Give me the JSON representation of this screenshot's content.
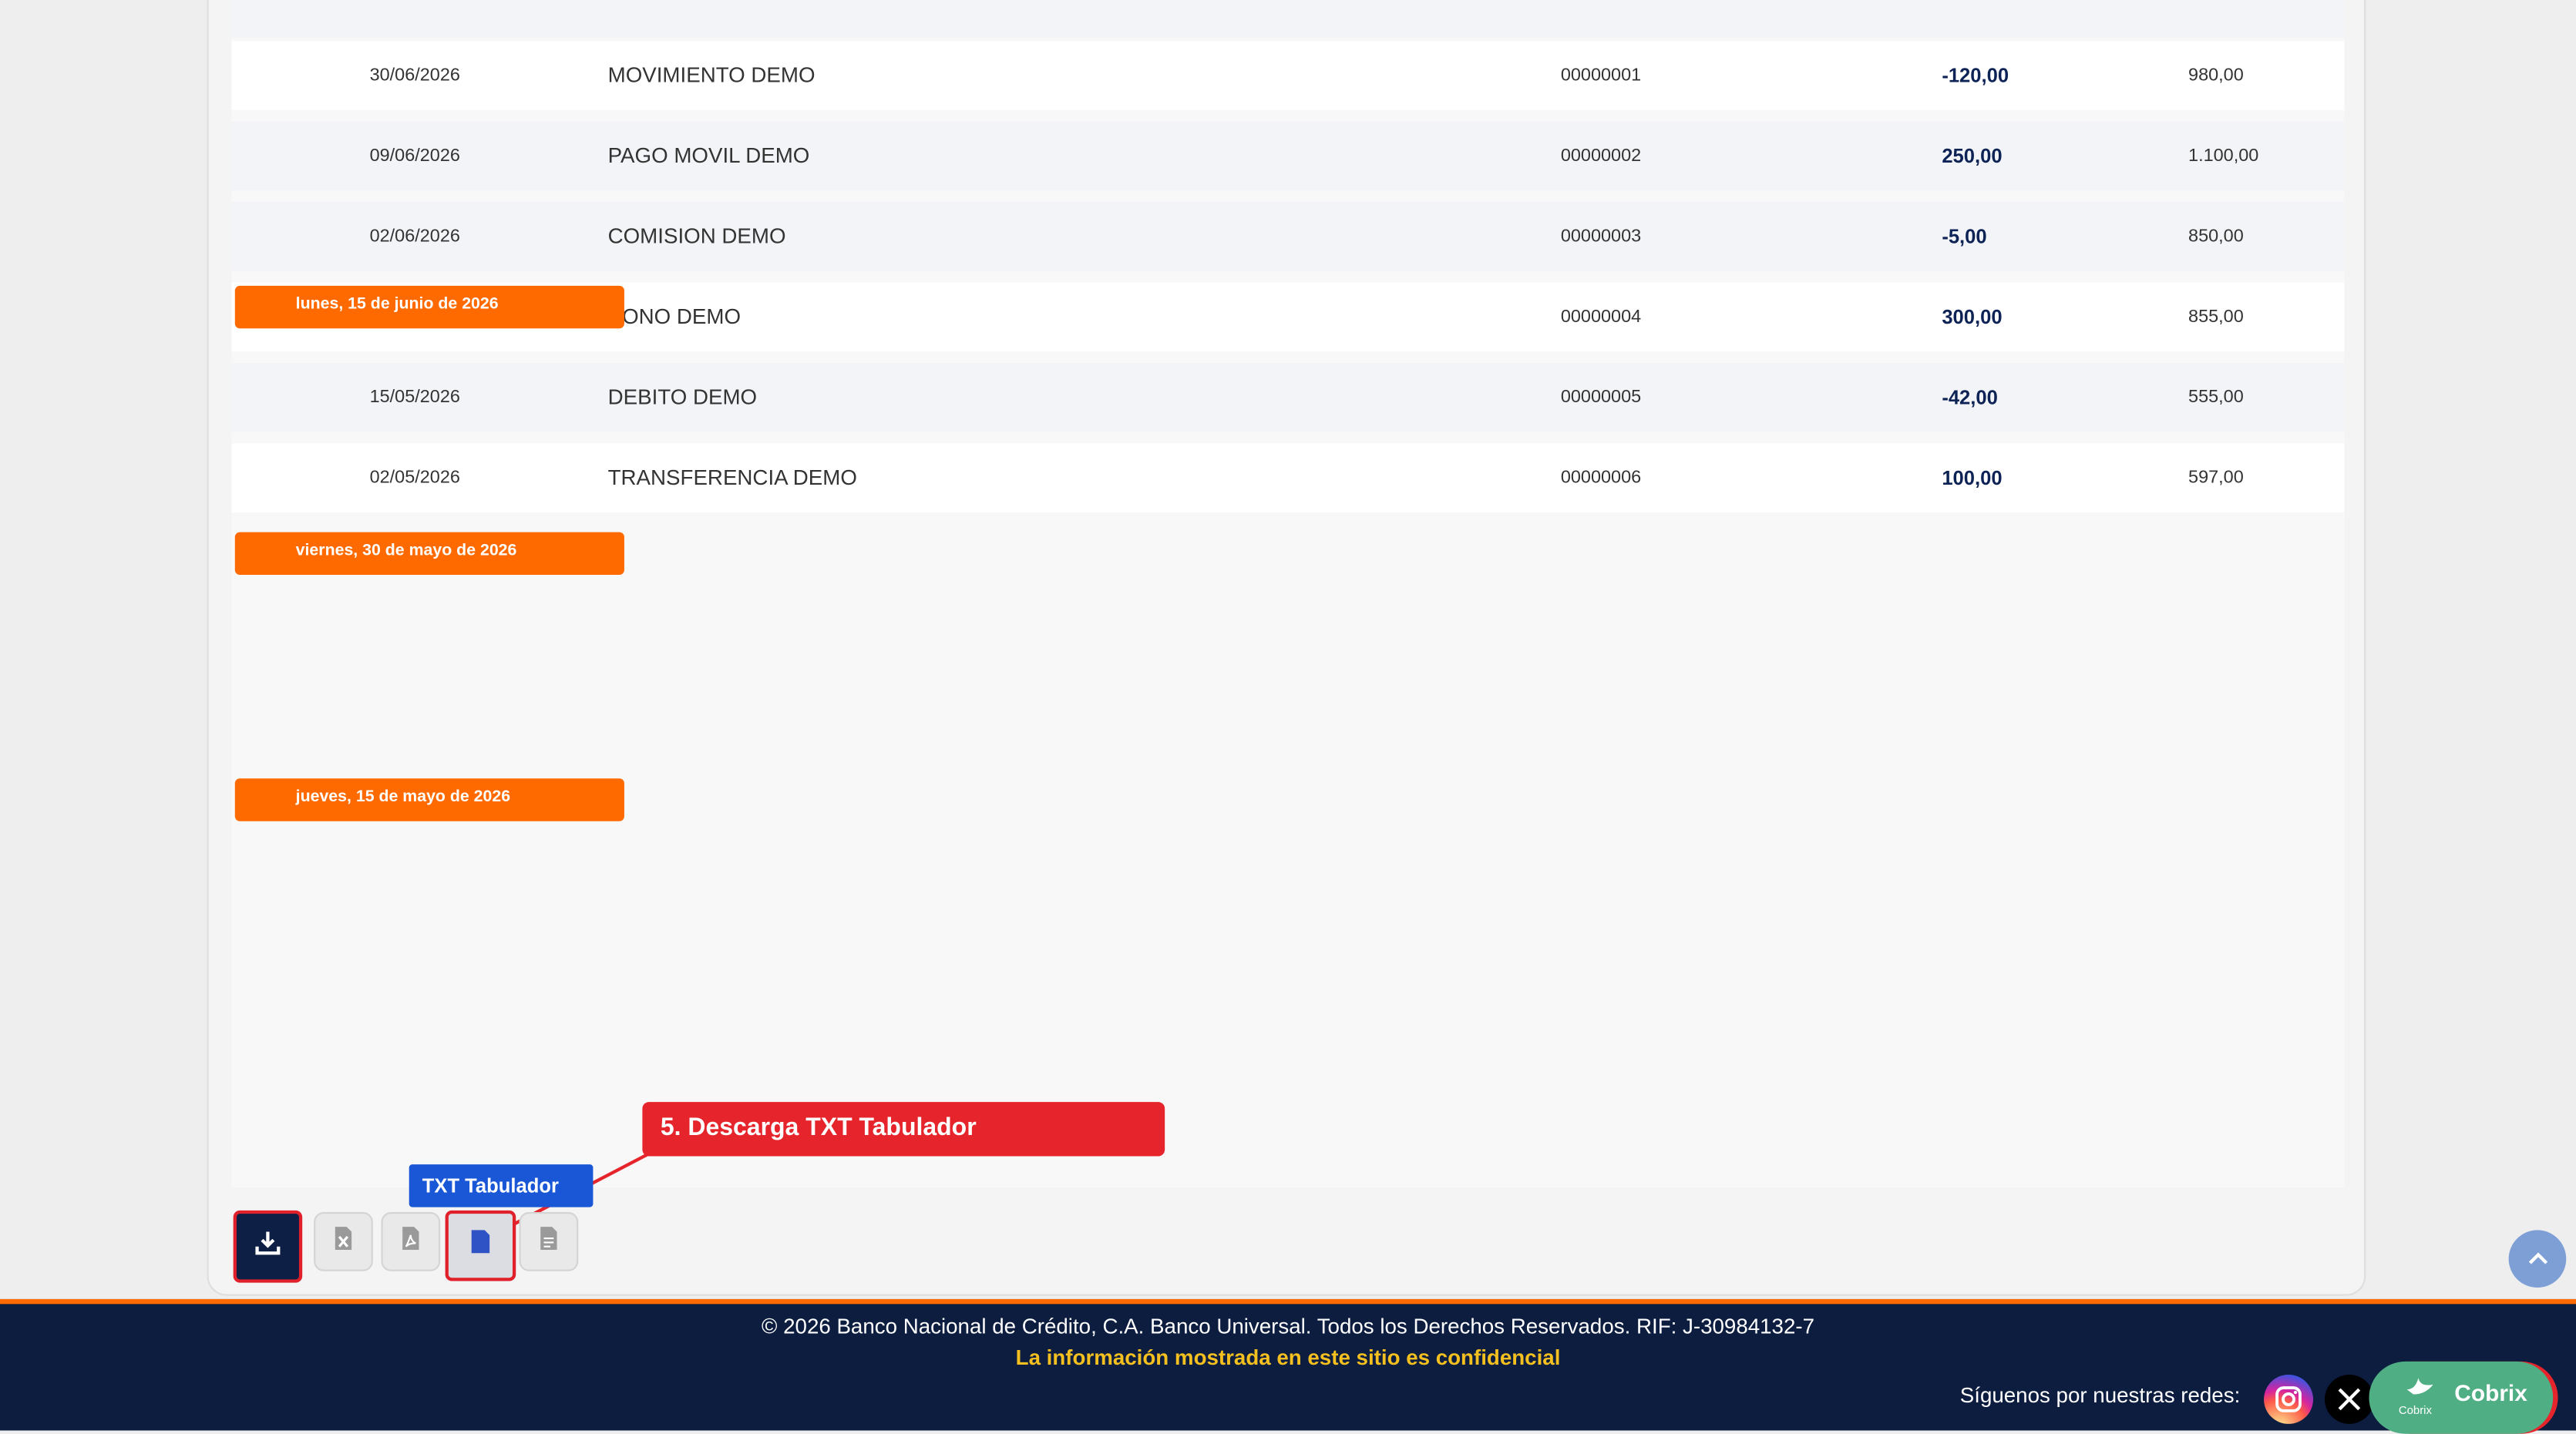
{
  "transactions": [
    {
      "date": "30/06/2026",
      "description": "MOVIMIENTO DEMO",
      "reference": "00000001",
      "amount": "-120,00",
      "balance": "980,00"
    },
    {
      "date": "09/06/2026",
      "description": "PAGO MOVIL DEMO",
      "reference": "00000002",
      "amount": "250,00",
      "balance": "1.100,00"
    },
    {
      "date": "02/06/2026",
      "description": "COMISION DEMO",
      "reference": "00000003",
      "amount": "-5,00",
      "balance": "850,00"
    },
    {
      "date": "",
      "description": "BONO DEMO",
      "reference": "00000004",
      "amount": "300,00",
      "balance": "855,00"
    },
    {
      "date": "15/05/2026",
      "description": "DEBITO DEMO",
      "reference": "00000005",
      "amount": "-42,00",
      "balance": "555,00"
    },
    {
      "date": "02/05/2026",
      "description": "TRANSFERENCIA DEMO",
      "reference": "00000006",
      "amount": "100,00",
      "balance": "597,00"
    }
  ],
  "date_badges": [
    "lunes, 15 de junio de 2026",
    "viernes, 30 de mayo de 2026",
    "jueves, 15 de mayo de 2026"
  ],
  "downloads": {
    "tooltip": "TXT Tabulador",
    "buttons": [
      "download-icon",
      "excel-file-icon",
      "pdf-file-icon",
      "txt-tab-file-icon",
      "txt-file-icon"
    ]
  },
  "callout": "5. Descarga TXT Tabulador",
  "footer": {
    "copyright": "© 2026 Banco Nacional de Crédito, C.A. Banco Universal.  Todos los Derechos Reservados. RIF: J-30984132-7",
    "confidential": "La información mostrada en este sitio es confidencial",
    "follow": "Síguenos por nuestras redes:",
    "chat_label": "Cobrix",
    "chat_sub": "Cobrix"
  },
  "colors": {
    "accent_orange": "#ff6a00",
    "navy": "#0c1d3f",
    "highlight_red": "#e5252b",
    "tooltip_blue": "#1a57d6",
    "chat_green": "#4fae83"
  }
}
